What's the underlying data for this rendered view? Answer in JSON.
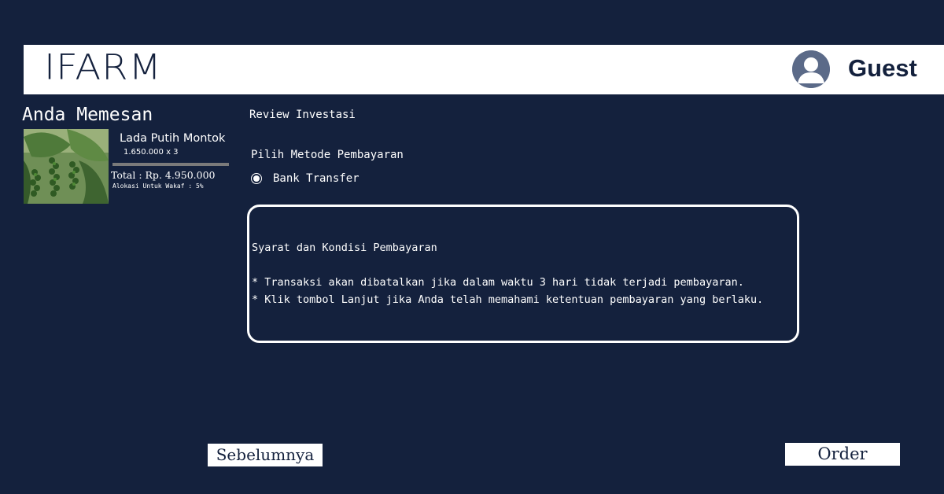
{
  "colors": {
    "background": "#14213d",
    "header_bg": "#ffffff",
    "text": "#ffffff",
    "button_bg": "#ffffff",
    "button_text": "#14213d"
  },
  "header": {
    "logo_text": "IFARM",
    "user_name": "Guest",
    "avatar_icon": "user-avatar-icon"
  },
  "order_summary": {
    "heading": "Anda Memesan",
    "product_name": "Lada Putih Montok",
    "quantity_line": "1.650.000 x 3",
    "total": "Total : Rp. 4.950.000",
    "wakaf_allocation": "Alokasi Untuk Wakaf : 5%"
  },
  "review": {
    "title": "Review Investasi",
    "payment_heading": "Pilih Metode Pembayaran",
    "payment_option": "Bank Transfer",
    "payment_selected": true
  },
  "terms": {
    "title": "Syarat dan Kondisi Pembayaran",
    "line1": "* Transaksi akan dibatalkan jika dalam waktu 3 hari tidak terjadi pembayaran.",
    "line2": "* Klik tombol Lanjut jika Anda telah memahami ketentuan pembayaran yang berlaku."
  },
  "buttons": {
    "previous": "Sebelumnya",
    "order": "Order"
  }
}
